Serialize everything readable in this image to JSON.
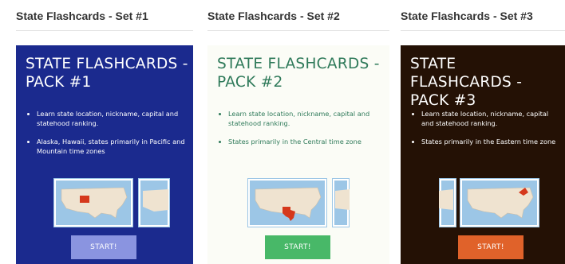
{
  "sets": [
    {
      "heading": "State Flashcards - Set #1",
      "card_title": "STATE FLASHCARDS -\nPACK #1",
      "bullets": [
        "Learn state location, nickname, capital and statehood ranking.",
        "Alaska, Hawaii, states primarily in Pacific and Mountain time zones"
      ],
      "button_label": "START!",
      "colors": {
        "background": "#1b2a8e",
        "title": "#ffffff",
        "text": "#ffffff",
        "button": "#8a94e0",
        "highlight": "#d5381c"
      }
    },
    {
      "heading": "State Flashcards - Set #2",
      "card_title": "STATE FLASHCARDS -\nPACK #2",
      "bullets": [
        "Learn state location, nickname, capital and statehood ranking.",
        "States primarily in the Central time zone"
      ],
      "button_label": "START!",
      "colors": {
        "background": "#fbfcf6",
        "title": "#2f7a5a",
        "text": "#2f7a5a",
        "button": "#48b868",
        "highlight": "#d5381c"
      }
    },
    {
      "heading": "State Flashcards - Set #3",
      "card_title": "STATE FLASHCARDS -\nPACK #3",
      "bullets": [
        "Learn state location, nickname, capital and statehood ranking.",
        "States primarily in the Eastern time zone"
      ],
      "button_label": "START!",
      "colors": {
        "background": "#241105",
        "title": "#ffffff",
        "text": "#ffffff",
        "button": "#e0622a",
        "highlight": "#d5381c"
      }
    }
  ]
}
